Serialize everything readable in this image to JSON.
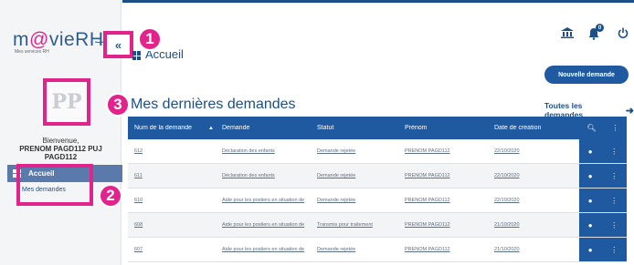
{
  "sidebar": {
    "logo_left": "m",
    "logo_at": "@",
    "logo_right": "vieRH",
    "logo_sub": "Mes services RH",
    "collapse_label": "«",
    "avatar_initials": "PP",
    "welcome": "Bienvenue,",
    "username": "PRENOM PAGD112 PUJ PAGD112",
    "nav_accueil": "Accueil",
    "nav_mes_demandes": "Mes demandes"
  },
  "callouts": [
    "1",
    "2",
    "3"
  ],
  "header": {
    "title": "Accueil",
    "notification_count": "0",
    "new_request_button": "Nouvelle demande"
  },
  "section": {
    "title": "Mes dernières demandes",
    "all_link": "Toutes les demandes"
  },
  "table": {
    "columns": [
      "Num de la demande",
      "Demande",
      "Statut",
      "Prénom",
      "Date de creation"
    ],
    "rows": [
      {
        "num": "612",
        "demande": "Déclaration des enfants",
        "statut": "Demande rejetée",
        "prenom": "PRENOM PAGD112",
        "date": "22/10/2020"
      },
      {
        "num": "611",
        "demande": "Déclaration des enfants",
        "statut": "Demande rejetée",
        "prenom": "PRENOM PAGD112",
        "date": "22/10/2020"
      },
      {
        "num": "610",
        "demande": "Aide pour les postiers en situation de",
        "statut": "Demande rejetée",
        "prenom": "PRENOM PAGD112",
        "date": "22/10/2020"
      },
      {
        "num": "608",
        "demande": "Aide pour les postiers en situation de",
        "statut": "Transmis pour traitement",
        "prenom": "PRENOM PAGD112",
        "date": "21/10/2020"
      },
      {
        "num": "607",
        "demande": "Aide pour les postiers en situation de",
        "statut": "Demande rejetée",
        "prenom": "PRENOM PAGD112",
        "date": "21/10/2020"
      }
    ]
  },
  "colors": {
    "brand_blue": "#1f5aa0",
    "highlight_pink": "#e2238b",
    "nav_active": "#5a7aab"
  },
  "icons": [
    "collapse-icon",
    "grid-icon",
    "bank-icon",
    "bell-icon",
    "power-icon",
    "search-icon",
    "more-icon",
    "eye-icon",
    "arrow-right-icon",
    "sort-up-icon"
  ]
}
